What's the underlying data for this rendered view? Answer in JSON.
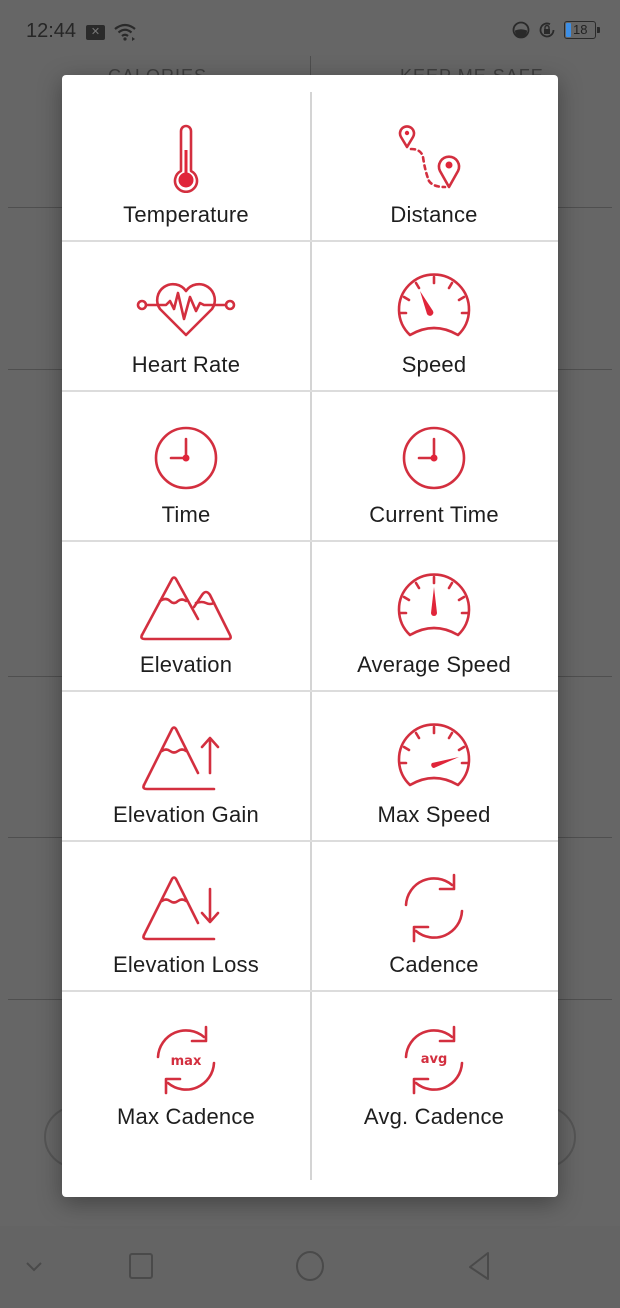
{
  "status_bar": {
    "time": "12:44",
    "battery_level": "18",
    "left_icons": [
      "notification-x-icon",
      "wifi-icon"
    ],
    "right_icons": [
      "data-saver-icon",
      "rotation-lock-icon",
      "battery-icon"
    ]
  },
  "background": {
    "headers": [
      "CALORIES",
      "KEEP ME SAFE"
    ]
  },
  "colors": {
    "accent": "#d32f3f",
    "overlay": "#666666",
    "dialog_bg": "#ffffff",
    "divider": "#d4d4d4"
  },
  "dialog": {
    "items": [
      {
        "label": "Temperature",
        "icon": "thermometer-icon"
      },
      {
        "label": "Distance",
        "icon": "map-route-icon"
      },
      {
        "label": "Heart Rate",
        "icon": "heart-rate-icon"
      },
      {
        "label": "Speed",
        "icon": "speedometer-icon"
      },
      {
        "label": "Time",
        "icon": "clock-icon"
      },
      {
        "label": "Current Time",
        "icon": "clock-icon"
      },
      {
        "label": "Elevation",
        "icon": "mountains-icon"
      },
      {
        "label": "Average Speed",
        "icon": "speedometer-average-icon"
      },
      {
        "label": "Elevation Gain",
        "icon": "mountain-up-arrow-icon"
      },
      {
        "label": "Max Speed",
        "icon": "speedometer-max-icon"
      },
      {
        "label": "Elevation Loss",
        "icon": "mountain-down-arrow-icon"
      },
      {
        "label": "Cadence",
        "icon": "cadence-cycle-icon"
      },
      {
        "label": "Max Cadence",
        "icon": "max-cadence-icon",
        "icon_text": "max"
      },
      {
        "label": "Avg. Cadence",
        "icon": "avg-cadence-icon",
        "icon_text": "avg"
      }
    ]
  },
  "nav_bar": {
    "buttons": [
      "hide-nav-icon",
      "recents-icon",
      "home-icon",
      "back-icon"
    ]
  }
}
